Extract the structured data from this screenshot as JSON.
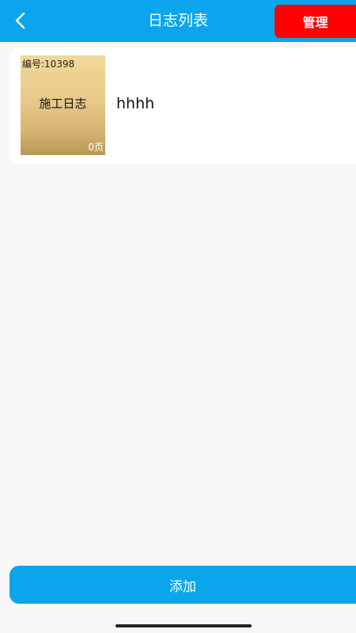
{
  "header": {
    "title": "日志列表",
    "back_icon": "chevron-left-icon",
    "manage_label": "管理"
  },
  "logs": [
    {
      "cover_id": "编号:10398",
      "cover_title": "施工日志",
      "cover_pages": "0页",
      "name": "hhhh"
    }
  ],
  "footer": {
    "add_label": "添加"
  },
  "colors": {
    "primary": "#0aa5ec",
    "danger": "#ff0000",
    "background": "#f7f7f7",
    "card": "#ffffff"
  }
}
